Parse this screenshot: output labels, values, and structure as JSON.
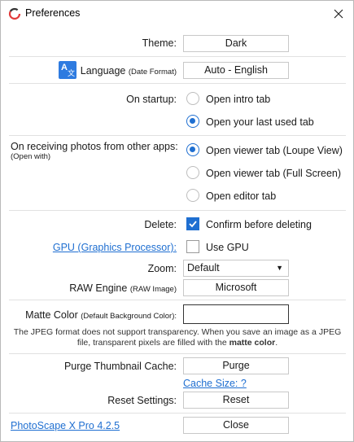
{
  "window": {
    "title": "Preferences"
  },
  "theme": {
    "label": "Theme:",
    "value": "Dark"
  },
  "language": {
    "label": "Language",
    "hint": "(Date Format)",
    "value": "Auto - English"
  },
  "startup": {
    "label": "On startup:",
    "options": [
      {
        "label": "Open intro tab",
        "selected": false
      },
      {
        "label": "Open your last used tab",
        "selected": true
      }
    ]
  },
  "receiving": {
    "label": "On receiving photos from other apps:",
    "hint": "(Open with)",
    "options": [
      {
        "label": "Open viewer tab (Loupe View)",
        "selected": true
      },
      {
        "label": "Open viewer tab (Full Screen)",
        "selected": false
      },
      {
        "label": "Open editor tab",
        "selected": false
      }
    ]
  },
  "delete": {
    "label": "Delete:",
    "checkbox_label": "Confirm before deleting",
    "checked": true
  },
  "gpu": {
    "link": "GPU (Graphics Processor):",
    "checkbox_label": "Use GPU",
    "checked": false
  },
  "zoom": {
    "label": "Zoom:",
    "value": "Default"
  },
  "raw_engine": {
    "label": "RAW Engine",
    "hint": "(RAW Image)",
    "value": "Microsoft"
  },
  "matte": {
    "label": "Matte Color",
    "hint": "(Default Background Color):",
    "value": "",
    "note_line1": "The JPEG format does not support transparency. When you save an image as a JPEG",
    "note_line2_prefix": "file, transparent pixels are filled with the ",
    "note_bold": "matte color",
    "note_suffix": "."
  },
  "purge": {
    "label": "Purge Thumbnail Cache:",
    "button": "Purge",
    "cache_link": "Cache Size: ?"
  },
  "reset": {
    "label": "Reset Settings:",
    "button": "Reset"
  },
  "footer": {
    "version_link": "PhotoScape X Pro 4.2.5",
    "close_button": "Close"
  },
  "colors": {
    "accent": "#1f6fd1",
    "separator": "#e1e1e1",
    "language_icon_bg": "#2e7be0"
  }
}
